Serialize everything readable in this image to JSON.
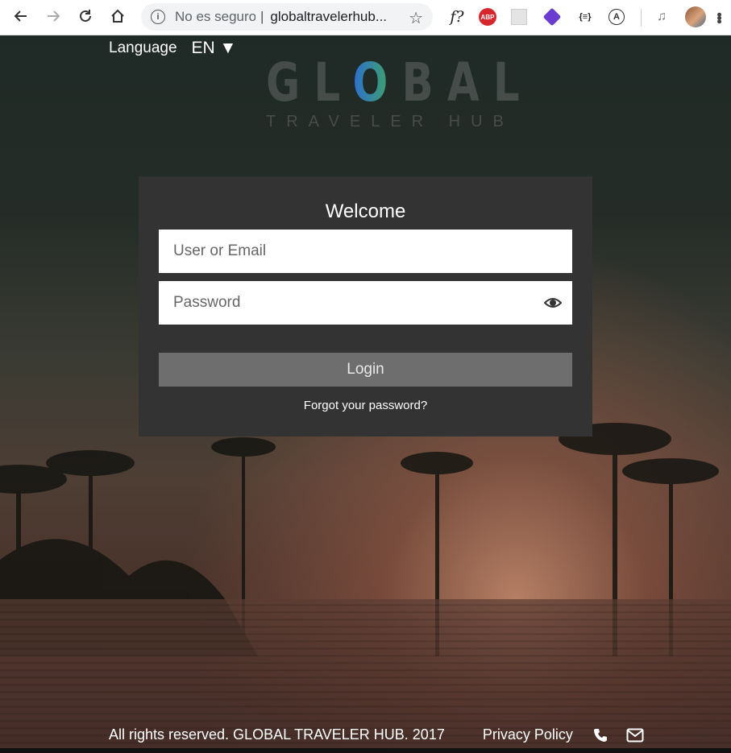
{
  "browser": {
    "security_text": "No es seguro",
    "url": "globaltravelerhub...",
    "extensions": {
      "abp_label": "ABP",
      "json_label": "{≡}",
      "a_label": "A",
      "f_label": "f?"
    }
  },
  "page": {
    "language": {
      "label": "Language",
      "value": "EN ▼"
    },
    "logo": {
      "main_prefix": "GL",
      "main_o": "O",
      "main_suffix": "BAL",
      "sub": "TRAVELER HUB"
    },
    "login": {
      "title": "Welcome",
      "user_placeholder": "User or Email",
      "password_placeholder": "Password",
      "button": "Login",
      "forgot": "Forgot your password?"
    },
    "footer": {
      "copyright": "All rights reserved. GLOBAL TRAVELER HUB. 2017",
      "privacy": "Privacy Policy"
    }
  }
}
